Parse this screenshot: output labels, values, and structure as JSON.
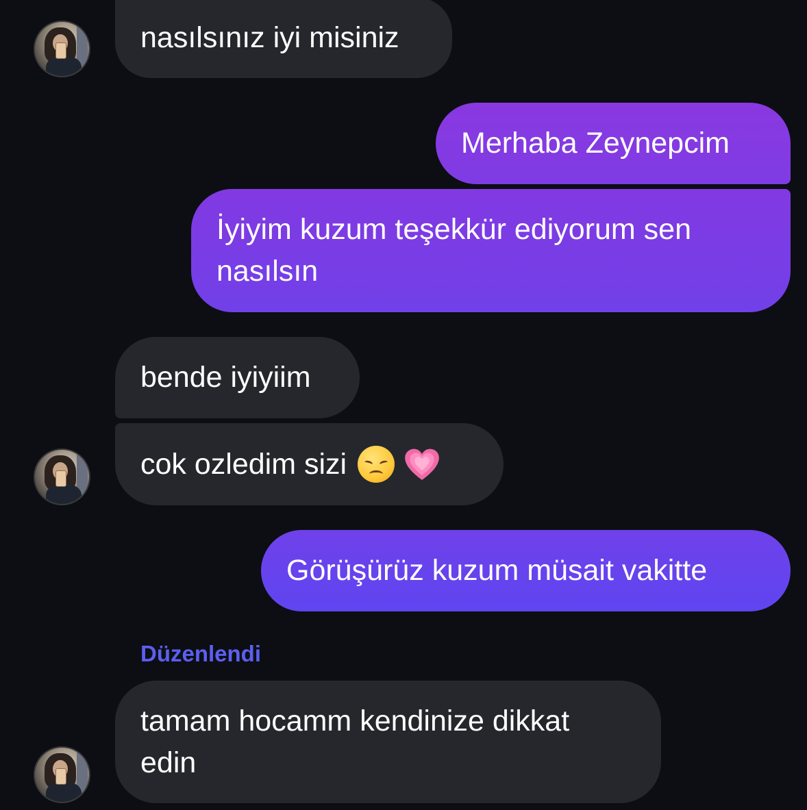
{
  "colors": {
    "background": "#0c0e13",
    "incoming_bubble": "#25272c",
    "outgoing_gradient_top": "#8a38e0",
    "outgoing_gradient_bottom": "#5c47f0",
    "edited_label": "#5b5ff0"
  },
  "messages": [
    {
      "direction": "incoming",
      "text": "nasılsınız iyi misiniz"
    },
    {
      "direction": "outgoing",
      "text": "Merhaba Zeynepcim"
    },
    {
      "direction": "outgoing",
      "line1": "İyiyim kuzum teşekkür ediyorum sen",
      "line2": "nasılsın"
    },
    {
      "direction": "incoming",
      "text": "bende iyiyiim"
    },
    {
      "direction": "incoming",
      "text": "cok ozledim sizi",
      "emojis": [
        "disappointed-face-emoji",
        "growing-heart-emoji"
      ]
    },
    {
      "direction": "outgoing",
      "text": "Görüşürüz kuzum müsait vakitte"
    },
    {
      "direction": "incoming",
      "edited_label": "Düzenlendi",
      "line1": "tamam hocamm kendinize dikkat",
      "line2": "edin"
    }
  ]
}
